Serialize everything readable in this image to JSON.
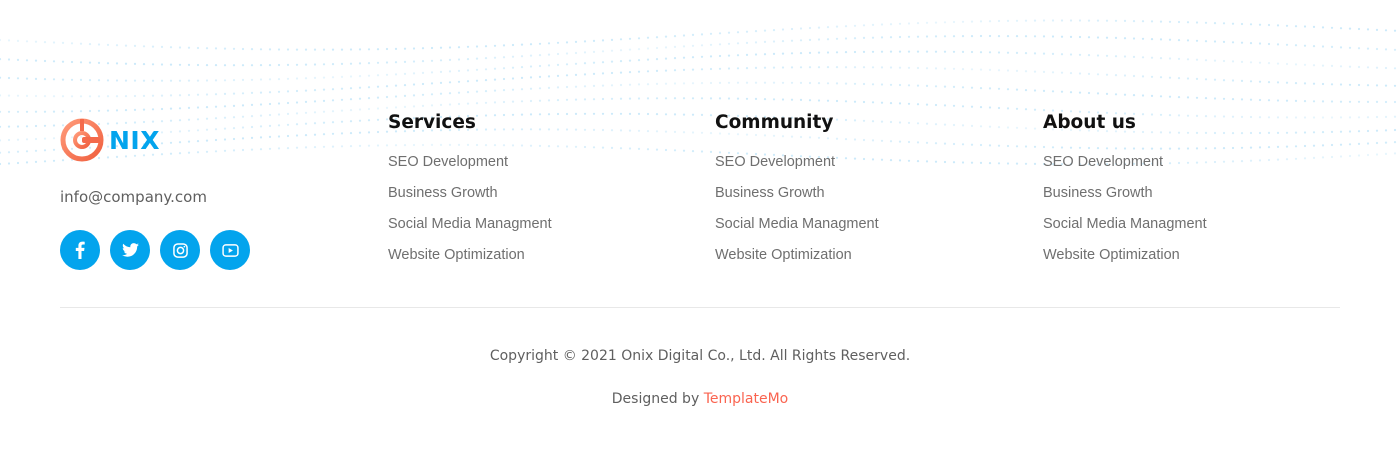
{
  "brand": {
    "name": "NIX",
    "email": "info@company.com"
  },
  "socials": [
    {
      "icon": "facebook-icon"
    },
    {
      "icon": "twitter-icon"
    },
    {
      "icon": "instagram-icon"
    },
    {
      "icon": "youtube-icon"
    }
  ],
  "columns": [
    {
      "title": "Services",
      "links": [
        "SEO Development",
        "Business Growth",
        "Social Media Managment",
        "Website Optimization"
      ]
    },
    {
      "title": "Community",
      "links": [
        "SEO Development",
        "Business Growth",
        "Social Media Managment",
        "Website Optimization"
      ]
    },
    {
      "title": "About us",
      "links": [
        "SEO Development",
        "Business Growth",
        "Social Media Managment",
        "Website Optimization"
      ]
    }
  ],
  "footer": {
    "copyright": "Copyright © 2021 Onix Digital Co., Ltd. All Rights Reserved.",
    "designed_prefix": "Designed by",
    "designed_link": "TemplateMo"
  },
  "colors": {
    "accent": "#03a4ed",
    "brand_orange": "#fa6450",
    "text_muted": "#6f6f6f",
    "heading": "#111111"
  }
}
